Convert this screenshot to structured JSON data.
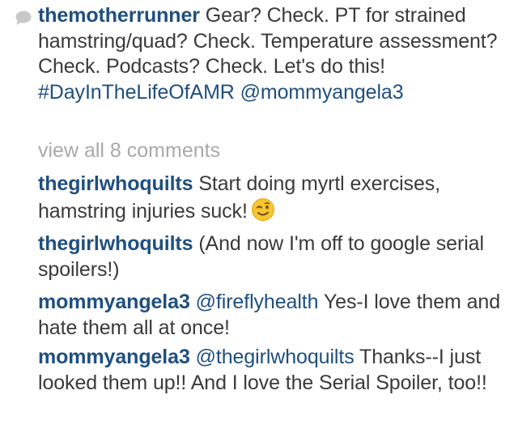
{
  "caption": {
    "username": "themotherrunner",
    "text": "Gear? Check. PT for strained hamstring/quad? Check. Temperature assessment? Check. Podcasts? Check. Let's do this!",
    "hashtag": "#DayInTheLifeOfAMR",
    "mention": "@mommyangela3"
  },
  "view_all_comments": "view all 8 comments",
  "comments": [
    {
      "username": "thegirlwhoquilts",
      "text": "Start doing myrtl exercises, hamstring injuries suck!",
      "emoji": "winking-face-emoji"
    },
    {
      "username": "thegirlwhoquilts",
      "text": "(And now I'm off to google serial spoilers!)"
    },
    {
      "username": "mommyangela3",
      "mention": "@fireflyhealth",
      "text": "Yes-I love them and hate them all at once!"
    },
    {
      "username": "mommyangela3",
      "mention": "@thegirlwhoquilts",
      "text": "Thanks--I just looked them up!! And I love the Serial Spoiler, too!!"
    }
  ],
  "colors": {
    "username": "#1f4f7f",
    "body_text": "#3a3a3a",
    "muted_text": "#a9a9a9",
    "background": "#ffffff",
    "emoji_face": "#f7c531"
  },
  "icons": {
    "comment": "speech-bubble-icon"
  }
}
